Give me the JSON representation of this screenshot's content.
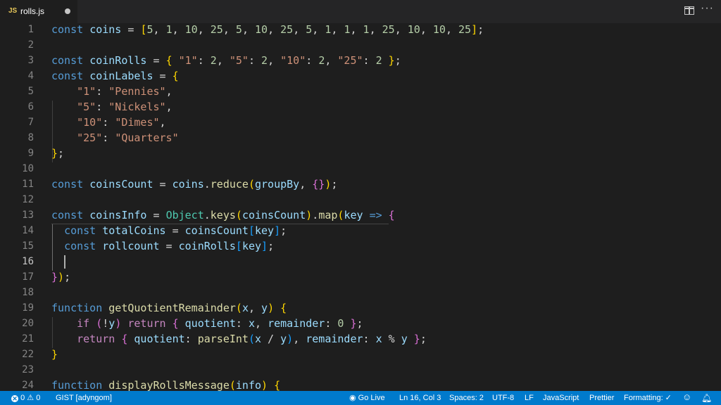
{
  "tab": {
    "icon": "JS",
    "filename": "rolls.js",
    "dirty": true
  },
  "actions": {
    "split": "split-editor-icon",
    "more": "···"
  },
  "editor": {
    "active_line": 16,
    "lines": [
      {
        "n": "1"
      },
      {
        "n": "2"
      },
      {
        "n": "3"
      },
      {
        "n": "4"
      },
      {
        "n": "5"
      },
      {
        "n": "6"
      },
      {
        "n": "7"
      },
      {
        "n": "8"
      },
      {
        "n": "9"
      },
      {
        "n": "10"
      },
      {
        "n": "11"
      },
      {
        "n": "12"
      },
      {
        "n": "13"
      },
      {
        "n": "14"
      },
      {
        "n": "15"
      },
      {
        "n": "16"
      },
      {
        "n": "17"
      },
      {
        "n": "18"
      },
      {
        "n": "19"
      },
      {
        "n": "20"
      },
      {
        "n": "21"
      },
      {
        "n": "22"
      },
      {
        "n": "23"
      },
      {
        "n": "24"
      }
    ],
    "code": {
      "l1": [
        "const",
        " ",
        "coins",
        " = ",
        "[",
        "5",
        ", ",
        "1",
        ", ",
        "10",
        ", ",
        "25",
        ", ",
        "5",
        ", ",
        "10",
        ", ",
        "25",
        ", ",
        "5",
        ", ",
        "1",
        ", ",
        "1",
        ", ",
        "1",
        ", ",
        "25",
        ", ",
        "10",
        ", ",
        "10",
        ", ",
        "25",
        "]",
        ";"
      ],
      "l3": [
        "const",
        " ",
        "coinRolls",
        " = ",
        "{",
        " ",
        "\"1\"",
        ": ",
        "2",
        ", ",
        "\"5\"",
        ": ",
        "2",
        ", ",
        "\"10\"",
        ": ",
        "2",
        ", ",
        "\"25\"",
        ": ",
        "2",
        " ",
        "}",
        ";"
      ],
      "l4": [
        "const",
        " ",
        "coinLabels",
        " = ",
        "{"
      ],
      "l5": [
        "    ",
        "\"1\"",
        ": ",
        "\"Pennies\"",
        ","
      ],
      "l6": [
        "    ",
        "\"5\"",
        ": ",
        "\"Nickels\"",
        ","
      ],
      "l7": [
        "    ",
        "\"10\"",
        ": ",
        "\"Dimes\"",
        ","
      ],
      "l8": [
        "    ",
        "\"25\"",
        ": ",
        "\"Quarters\""
      ],
      "l9": [
        "}",
        ";"
      ],
      "l11": [
        "const",
        " ",
        "coinsCount",
        " = ",
        "coins",
        ".",
        "reduce",
        "(",
        "groupBy",
        ", ",
        "{}",
        ")",
        ";"
      ],
      "l13": [
        "const",
        " ",
        "coinsInfo",
        " = ",
        "Object",
        ".",
        "keys",
        "(",
        "coinsCount",
        ")",
        ".",
        "map",
        "(",
        "key",
        " ",
        "=>",
        " ",
        "{"
      ],
      "l14": [
        "  ",
        "const",
        " ",
        "totalCoins",
        " = ",
        "coinsCount",
        "[",
        "key",
        "]",
        ";"
      ],
      "l15": [
        "  ",
        "const",
        " ",
        "rollcount",
        " = ",
        "coinRolls",
        "[",
        "key",
        "]",
        ";"
      ],
      "l17": [
        "}",
        ")",
        ";"
      ],
      "l19": [
        "function",
        " ",
        "getQuotientRemainder",
        "(",
        "x",
        ", ",
        "y",
        ")",
        " ",
        "{"
      ],
      "l20": [
        "    ",
        "if",
        " ",
        "(",
        "!",
        "y",
        ")",
        " ",
        "return",
        " ",
        "{",
        " ",
        "quotient",
        ": ",
        "x",
        ", ",
        "remainder",
        ": ",
        "0",
        " ",
        "}",
        ";"
      ],
      "l21": [
        "    ",
        "return",
        " ",
        "{",
        " ",
        "quotient",
        ": ",
        "parseInt",
        "(",
        "x",
        " / ",
        "y",
        ")",
        ", ",
        "remainder",
        ": ",
        "x",
        " % ",
        "y",
        " ",
        "}",
        ";"
      ],
      "l22": [
        "}"
      ],
      "l24": [
        "function",
        " ",
        "displayRollsMessage",
        "(",
        "info",
        ")",
        " ",
        "{"
      ]
    }
  },
  "status": {
    "errors": "0",
    "warnings": "0",
    "branch": "GIST [adyngom]",
    "go_live": "Go Live",
    "position": "Ln 16, Col 3",
    "spaces": "Spaces: 2",
    "encoding": "UTF-8",
    "eol": "LF",
    "language": "JavaScript",
    "prettier": "Prettier",
    "formatting": "Formatting: ✓"
  },
  "colors": {
    "statusbar": "#007acc",
    "editor_bg": "#1e1e1e",
    "keyword": "#569cd6",
    "control": "#c586c0",
    "string": "#ce9178",
    "number": "#b5cea8",
    "function": "#dcdcaa",
    "variable": "#9cdcfe"
  }
}
